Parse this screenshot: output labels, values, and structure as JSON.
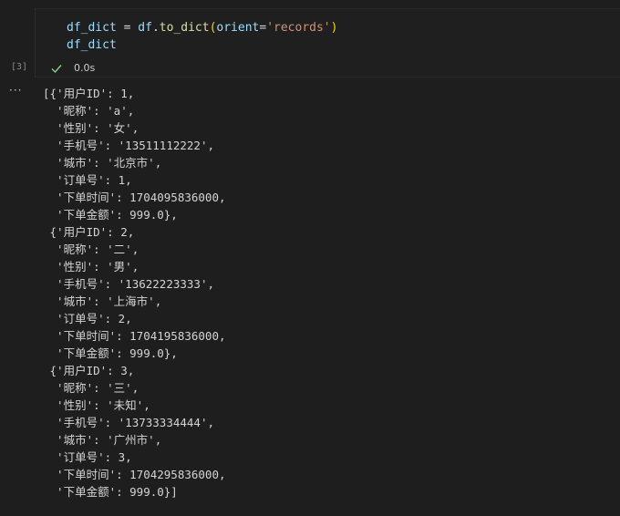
{
  "cell": {
    "execution_count": "[3]",
    "code": {
      "line1": {
        "var": "df_dict",
        "op": " = ",
        "obj": "df",
        "dot": ".",
        "fn": "to_dict",
        "open": "(",
        "param": "orient",
        "eq": "=",
        "str": "'records'",
        "close": ")"
      },
      "line2": "df_dict"
    },
    "status": {
      "icon": "check-icon",
      "time": "0.0s",
      "color": "#89d185"
    }
  },
  "output": {
    "menu_glyph": "···",
    "lines": [
      "[{'用户ID': 1,",
      "  '昵称': 'a',",
      "  '性别': '女',",
      "  '手机号': '13511112222',",
      "  '城市': '北京市',",
      "  '订单号': 1,",
      "  '下单时间': 1704095836000,",
      "  '下单金额': 999.0},",
      " {'用户ID': 2,",
      "  '昵称': '二',",
      "  '性别': '男',",
      "  '手机号': '13622223333',",
      "  '城市': '上海市',",
      "  '订单号': 2,",
      "  '下单时间': 1704195836000,",
      "  '下单金额': 999.0},",
      " {'用户ID': 3,",
      "  '昵称': '三',",
      "  '性别': '未知',",
      "  '手机号': '13733334444',",
      "  '城市': '广州市',",
      "  '订单号': 3,",
      "  '下单时间': 1704295836000,",
      "  '下单金额': 999.0}]"
    ]
  }
}
